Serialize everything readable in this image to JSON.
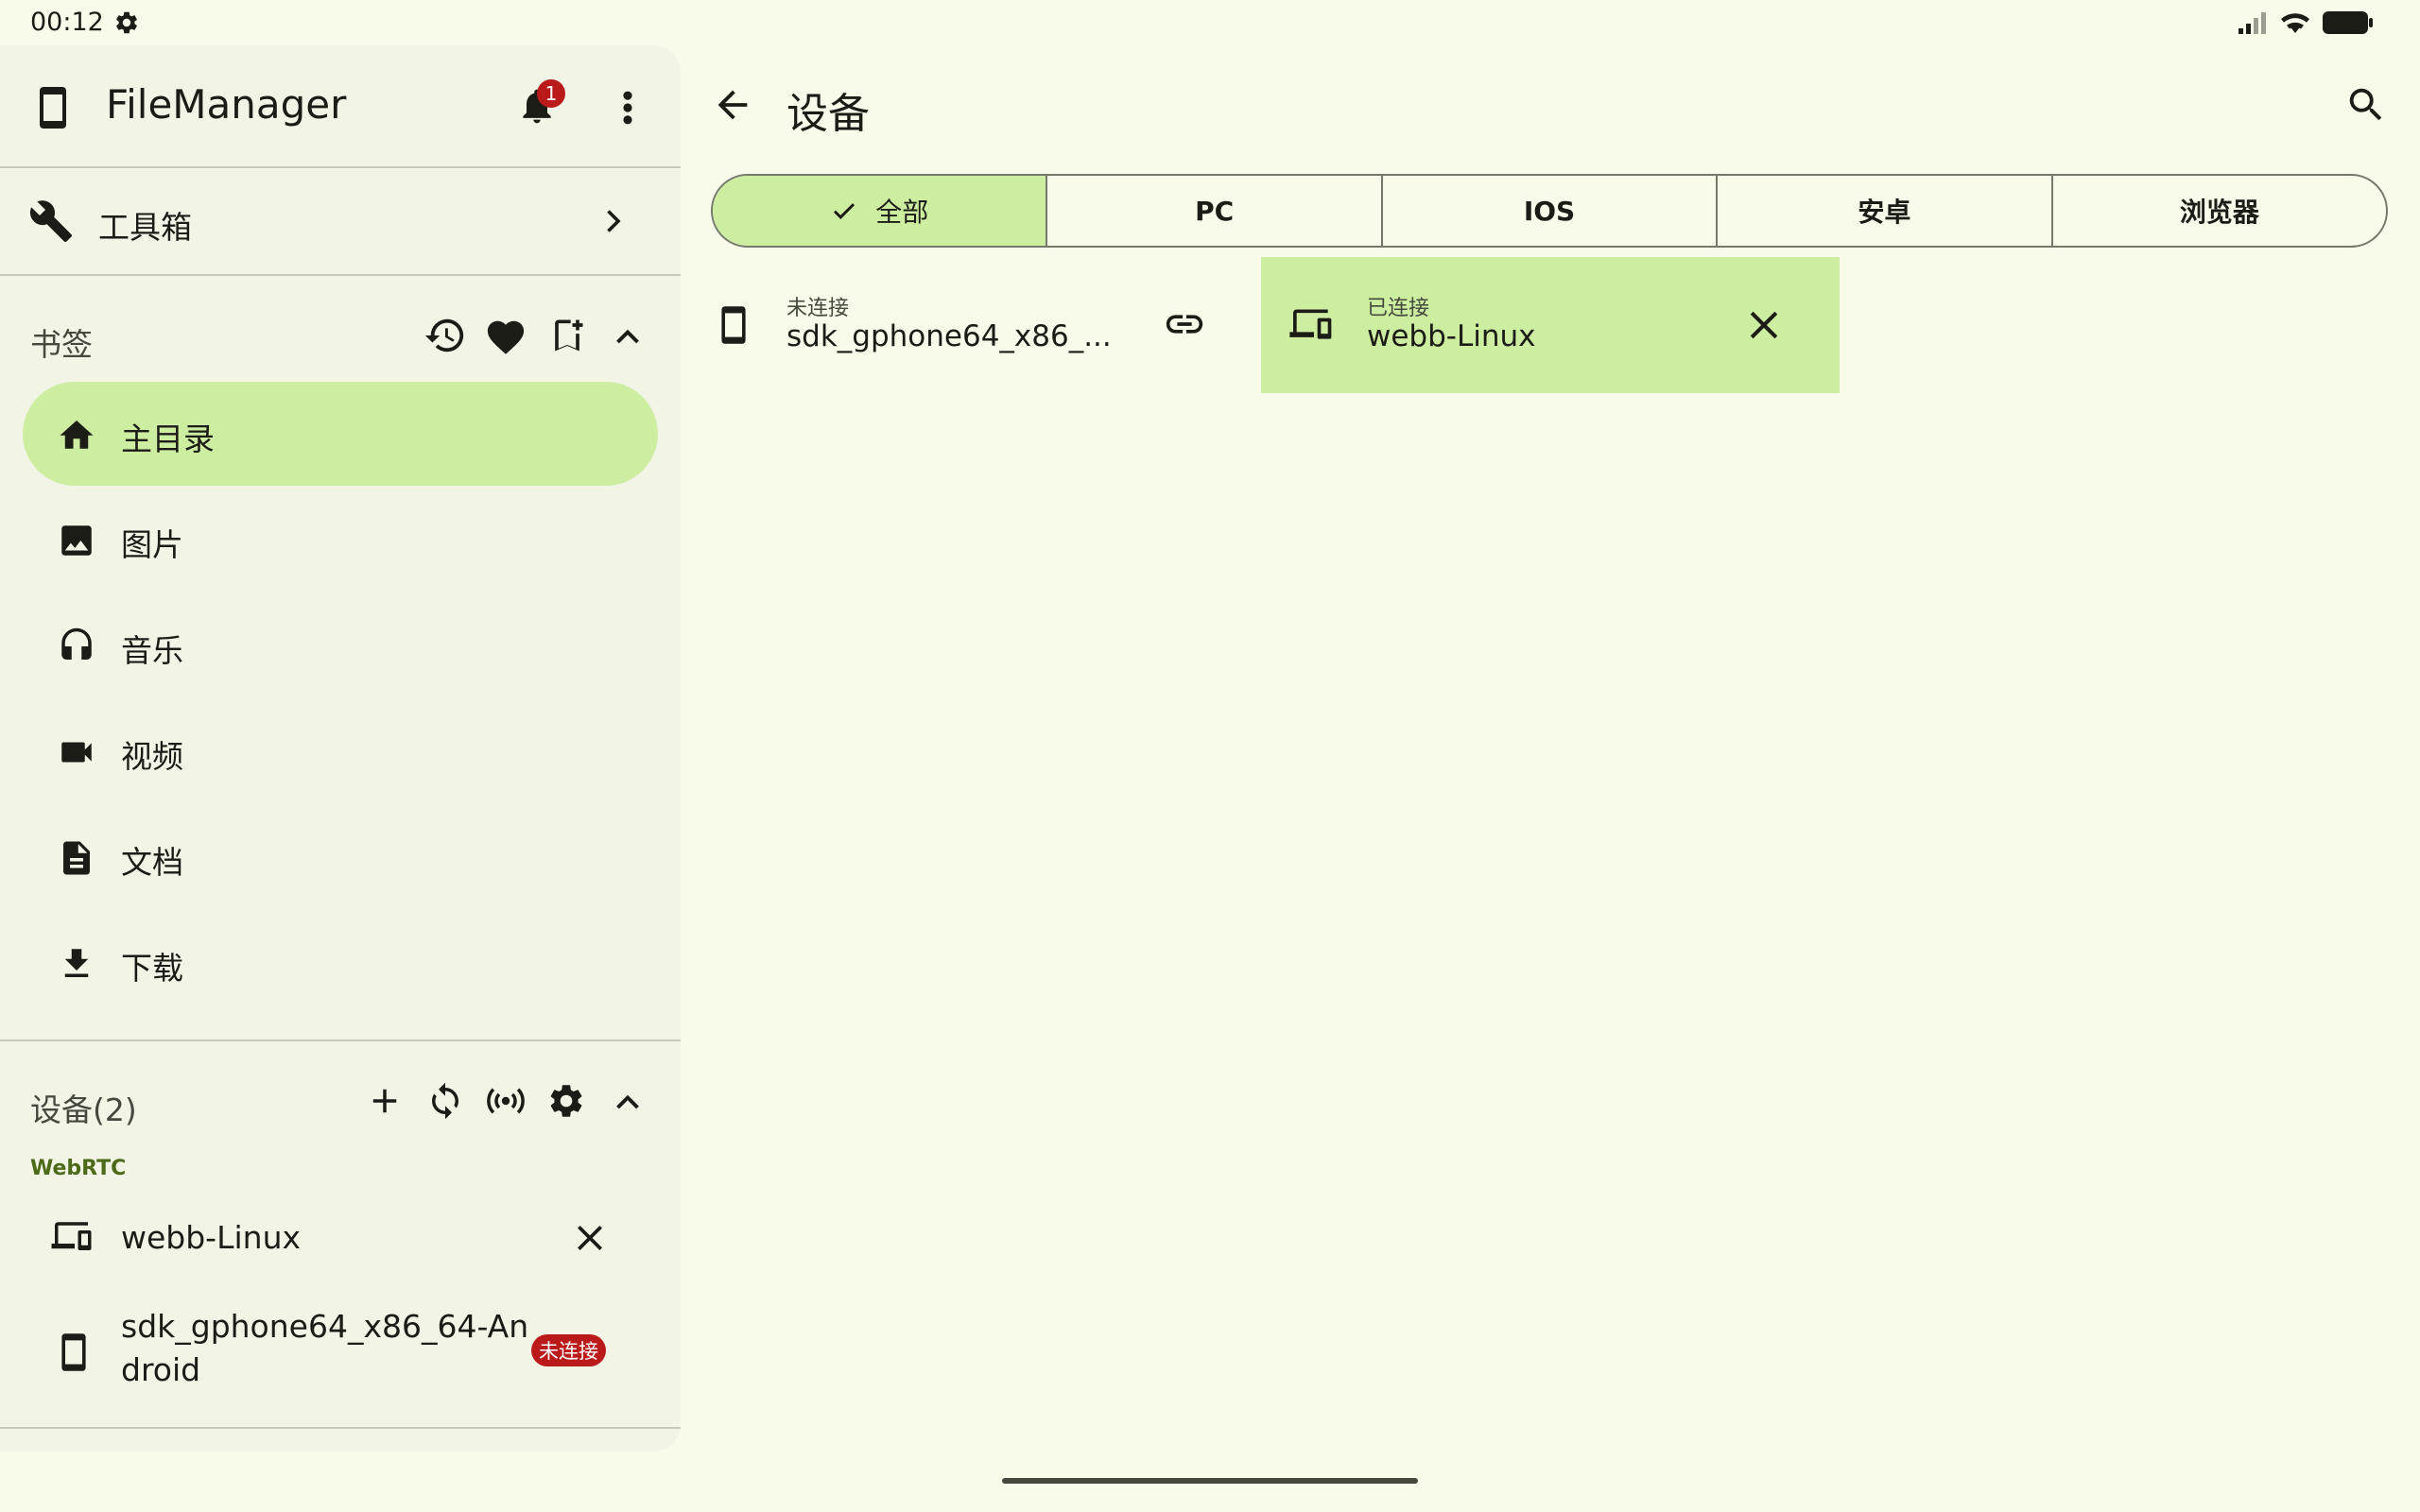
{
  "status_bar": {
    "time": "00:12"
  },
  "sidebar": {
    "app_title": "FileManager",
    "notification_count": "1",
    "toolbox_label": "工具箱",
    "bookmarks_title": "书签",
    "nav_items": [
      {
        "label": "主目录",
        "icon": "home-icon",
        "active": true
      },
      {
        "label": "图片",
        "icon": "image-icon"
      },
      {
        "label": "音乐",
        "icon": "headphones-icon"
      },
      {
        "label": "视频",
        "icon": "videocam-icon"
      },
      {
        "label": "文档",
        "icon": "document-icon"
      },
      {
        "label": "下载",
        "icon": "download-icon"
      }
    ],
    "devices_title": "设备(2)",
    "webrtc_label": "WebRTC",
    "devices": [
      {
        "name": "webb-Linux",
        "icon": "devices-icon"
      },
      {
        "name_line1": "sdk_gphone64_x86_64-An",
        "name_line2": "droid",
        "badge": "未连接",
        "icon": "phone-icon"
      }
    ]
  },
  "main": {
    "title": "设备",
    "tabs": [
      {
        "label": "全部",
        "selected": true
      },
      {
        "label": "PC"
      },
      {
        "label": "IOS"
      },
      {
        "label": "安卓"
      },
      {
        "label": "浏览器"
      }
    ],
    "cards": [
      {
        "status": "未连接",
        "name": "sdk_gphone64_x86_...",
        "connected": false
      },
      {
        "status": "已连接",
        "name": "webb-Linux",
        "connected": true
      }
    ]
  },
  "colors": {
    "background": "#f8fbea",
    "sidebar": "#f2f4e6",
    "accent": "#cdeea1",
    "badge": "#ba1a1a",
    "webrtc_label": "#4c6a1a"
  }
}
